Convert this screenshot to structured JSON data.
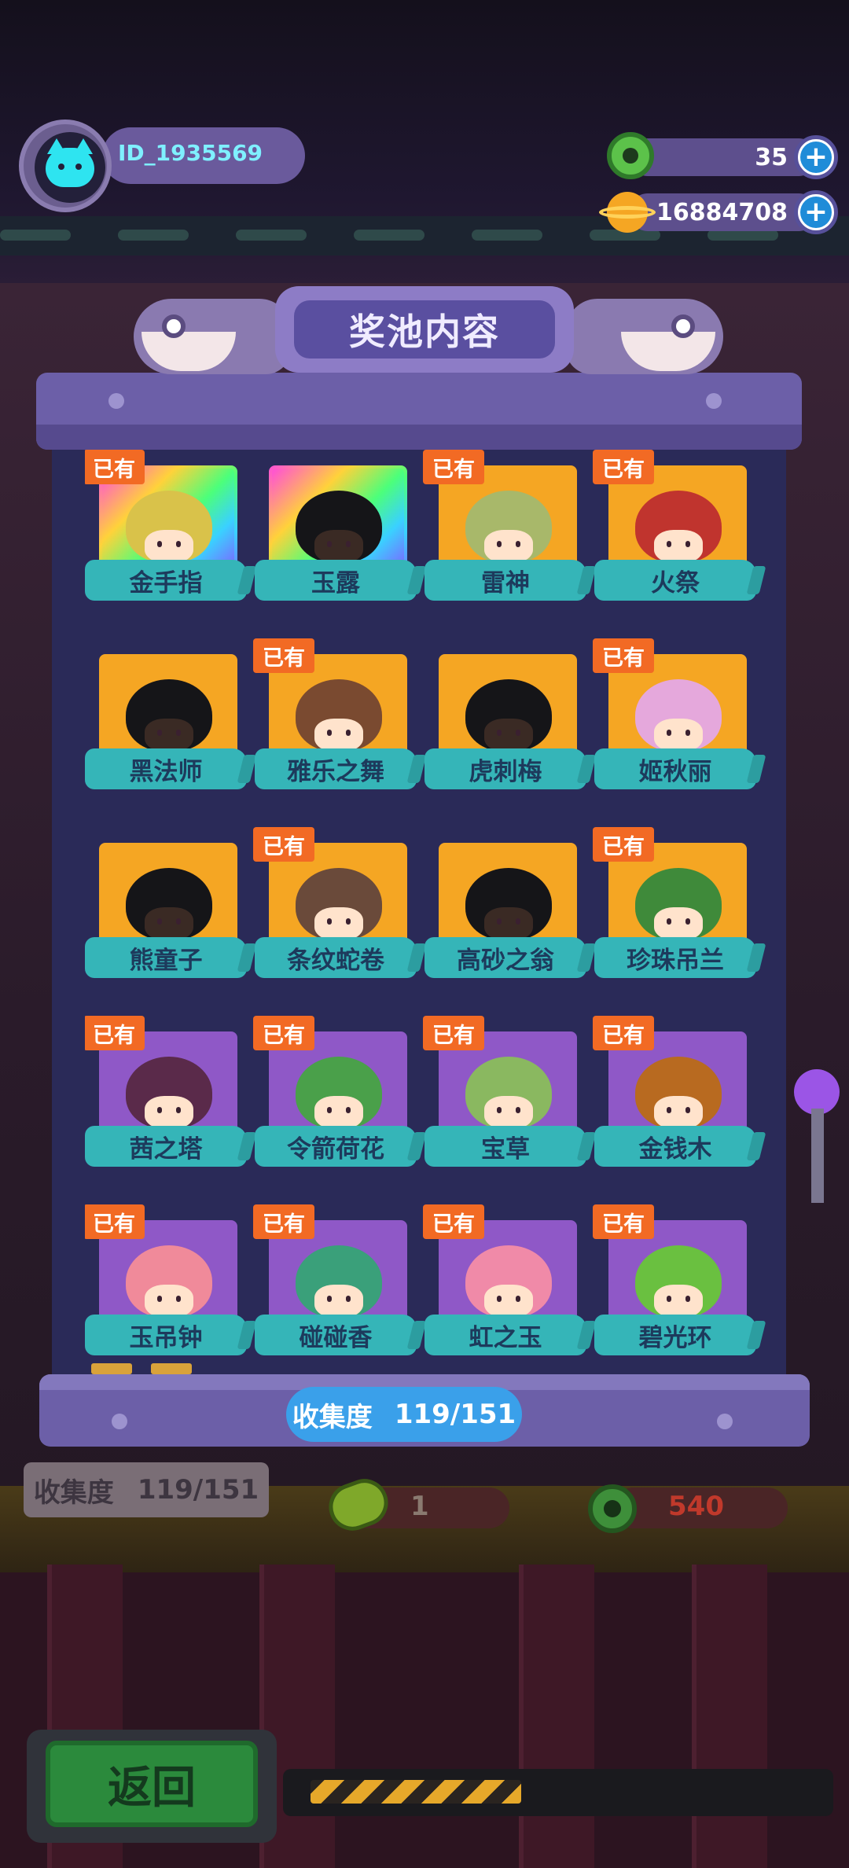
{
  "header": {
    "player_id": "ID_1935569",
    "currencies": [
      {
        "icon": "green-donut-icon",
        "value": "35"
      },
      {
        "icon": "planet-coin-icon",
        "value": "16884708"
      }
    ],
    "add_label": "+"
  },
  "dialog": {
    "title": "奖池内容",
    "owned_badge": "已有",
    "collection_label": "收集度",
    "collection_value": "119/151",
    "items": [
      {
        "name": "金手指",
        "owned": true,
        "rarity": "rainbow"
      },
      {
        "name": "玉露",
        "owned": false,
        "rarity": "rainbow"
      },
      {
        "name": "雷神",
        "owned": true,
        "rarity": "orange"
      },
      {
        "name": "火祭",
        "owned": true,
        "rarity": "orange"
      },
      {
        "name": "黑法师",
        "owned": false,
        "rarity": "orange"
      },
      {
        "name": "雅乐之舞",
        "owned": true,
        "rarity": "orange"
      },
      {
        "name": "虎刺梅",
        "owned": false,
        "rarity": "orange"
      },
      {
        "name": "姬秋丽",
        "owned": true,
        "rarity": "orange"
      },
      {
        "name": "熊童子",
        "owned": false,
        "rarity": "orange"
      },
      {
        "name": "条纹蛇卷",
        "owned": true,
        "rarity": "orange"
      },
      {
        "name": "高砂之翁",
        "owned": false,
        "rarity": "orange"
      },
      {
        "name": "珍珠吊兰",
        "owned": true,
        "rarity": "orange"
      },
      {
        "name": "茜之塔",
        "owned": true,
        "rarity": "purple"
      },
      {
        "name": "令箭荷花",
        "owned": true,
        "rarity": "purple"
      },
      {
        "name": "宝草",
        "owned": true,
        "rarity": "purple"
      },
      {
        "name": "金钱木",
        "owned": true,
        "rarity": "purple"
      },
      {
        "name": "玉吊钟",
        "owned": true,
        "rarity": "purple"
      },
      {
        "name": "碰碰香",
        "owned": true,
        "rarity": "purple"
      },
      {
        "name": "虹之玉",
        "owned": true,
        "rarity": "purple"
      },
      {
        "name": "碧光环",
        "owned": true,
        "rarity": "purple"
      }
    ]
  },
  "machine": {
    "collection_label": "收集度",
    "collection_value": "119/151",
    "cost_count": "1",
    "cost_price": "540"
  },
  "footer": {
    "back_label": "返回"
  },
  "colors": {
    "panel": "#6c5fa8",
    "panel_bg": "#2a2a58",
    "ribbon": "#35b5b8",
    "badge": "#f26a24",
    "orange_rarity": "#f5a623",
    "purple_rarity": "#8f58c7",
    "collect_pill": "#3aa0ea"
  }
}
